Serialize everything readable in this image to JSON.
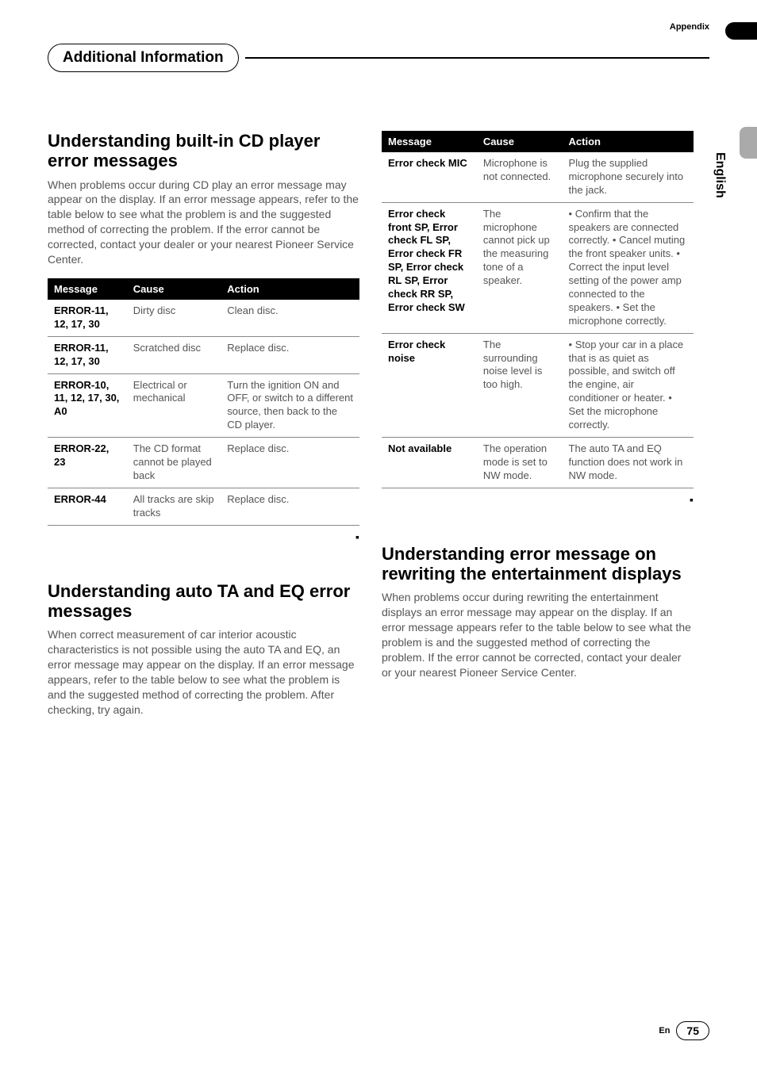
{
  "header": {
    "appendix": "Appendix",
    "section_title": "Additional Information",
    "side_label": "English"
  },
  "col1": {
    "sec1": {
      "heading": "Understanding built-in CD player error messages",
      "body": "When problems occur during CD play an error message may appear on the display. If an error message appears, refer to the table below to see what the problem is and the suggested method of correcting the problem. If the error cannot be corrected, contact your dealer or your nearest Pioneer Service Center.",
      "th_message": "Message",
      "th_cause": "Cause",
      "th_action": "Action",
      "rows": [
        {
          "msg": "ERROR-11, 12, 17, 30",
          "cause": "Dirty disc",
          "action": "Clean disc."
        },
        {
          "msg": "ERROR-11, 12, 17, 30",
          "cause": "Scratched disc",
          "action": "Replace disc."
        },
        {
          "msg": "ERROR-10, 11, 12, 17, 30, A0",
          "cause": "Electrical or mechanical",
          "action": "Turn the ignition ON and OFF, or switch to a different source, then back to the CD player."
        },
        {
          "msg": "ERROR-22, 23",
          "cause": "The CD format cannot be played back",
          "action": "Replace disc."
        },
        {
          "msg": "ERROR-44",
          "cause": "All tracks are skip tracks",
          "action": "Replace disc."
        }
      ]
    },
    "sec2": {
      "heading": "Understanding auto TA and EQ error messages",
      "body": "When correct measurement of car interior acoustic characteristics is not possible using the auto TA and EQ, an error message may appear on the display. If an error message appears, refer to the table below to see what the problem is and the suggested method of correcting the problem. After checking, try again."
    }
  },
  "col2": {
    "sec1": {
      "th_message": "Message",
      "th_cause": "Cause",
      "th_action": "Action",
      "rows": [
        {
          "msg": "Error check MIC",
          "cause": "Microphone is not connected.",
          "action": "Plug the supplied microphone securely into the jack."
        },
        {
          "msg": "Error check front SP, Error check FL SP, Error check FR SP, Error check RL SP, Error check RR SP, Error check SW",
          "cause": "The microphone cannot pick up the measuring tone of a speaker.",
          "action": "• Confirm that the speakers are connected correctly.\n• Cancel muting the front speaker units.\n• Correct the input level setting of the power amp connected to the speakers.\n• Set the microphone correctly."
        },
        {
          "msg": "Error check noise",
          "cause": "The surrounding noise level is too high.",
          "action": "• Stop your car in a place that is as quiet as possible, and switch off the engine, air conditioner or heater.\n• Set the microphone correctly."
        },
        {
          "msg": "Not available",
          "cause": "The operation mode is set to NW mode.",
          "action": "The auto TA and EQ function does not work in NW mode."
        }
      ]
    },
    "sec2": {
      "heading": "Understanding error message on rewriting the entertainment displays",
      "body": "When problems occur during rewriting the entertainment displays an error message may appear on the display. If an error message appears refer to the table below to see what the problem is and the suggested method of correcting the problem. If the error cannot be corrected, contact your dealer or your nearest Pioneer Service Center."
    }
  },
  "end_mark": "▪",
  "footer": {
    "lang": "En",
    "page": "75"
  }
}
